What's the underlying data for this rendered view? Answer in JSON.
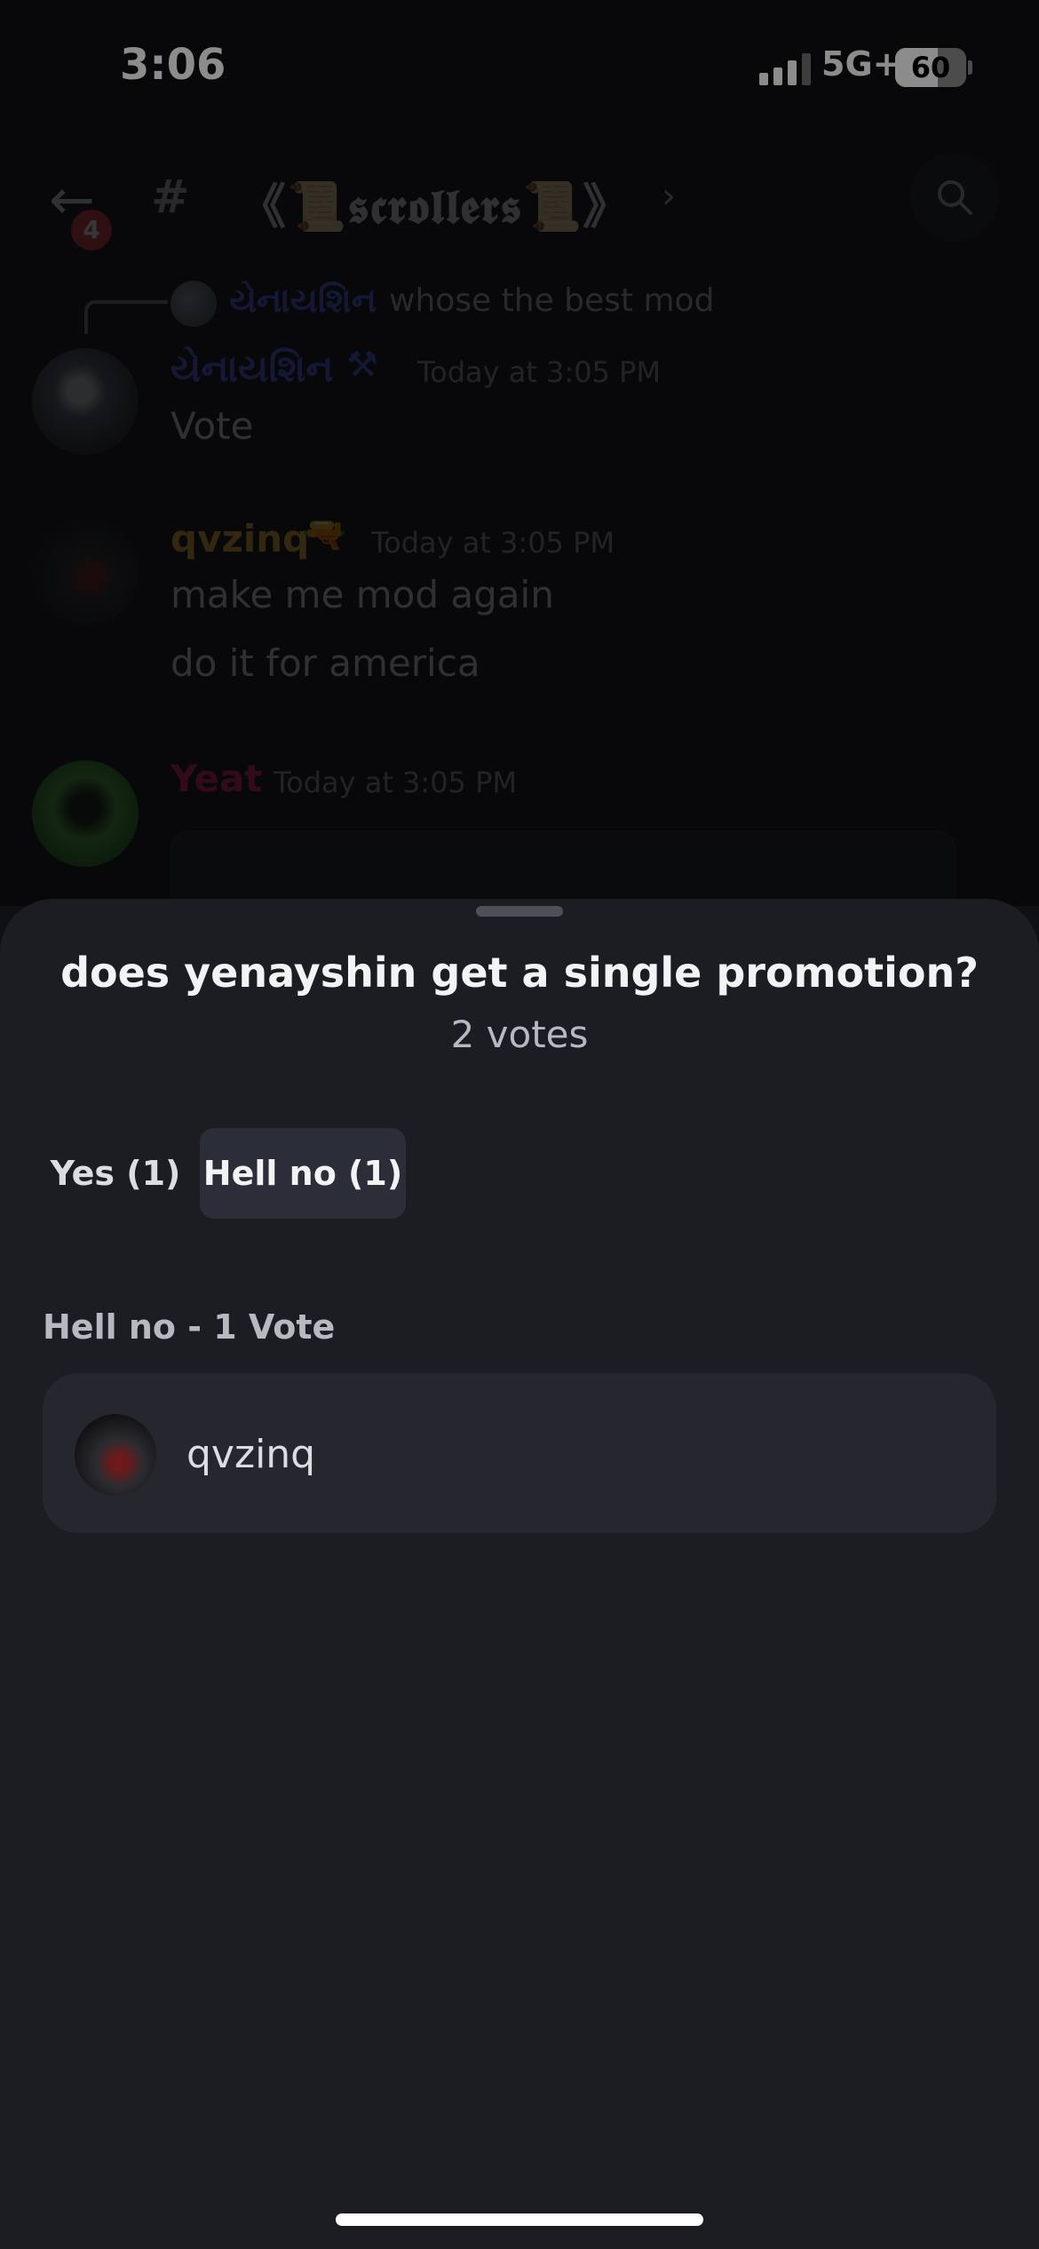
{
  "status_bar": {
    "time": "3:06",
    "network": "5G+",
    "battery": "60",
    "battery_level": 0.6,
    "signal_bars": 3
  },
  "header": {
    "unread_badge": "4",
    "channel_icon": "#",
    "channel_name": "《📜𝖘𝖈𝖗𝖔𝖑𝖑𝖊𝖗𝖘📜》",
    "chevron": "›"
  },
  "chat": {
    "reply": {
      "username": "યેનાયશિન",
      "text": "whose the best mod"
    },
    "messages": [
      {
        "username": "યેનાયશિન",
        "role_icon": "⚒",
        "timestamp": "Today at 3:05 PM",
        "lines": [
          "Vote"
        ]
      },
      {
        "username": "qvzinq",
        "role_icon": "🔫",
        "timestamp": "Today at 3:05 PM",
        "lines": [
          "make me mod again",
          "do it for america"
        ]
      },
      {
        "username": "Yeat",
        "timestamp": "Today at 3:05 PM",
        "lines": []
      }
    ]
  },
  "poll": {
    "question": "does yenayshin get a single promotion?",
    "total_votes": "2 votes",
    "tabs": [
      {
        "label": "Yes (1)",
        "selected": false
      },
      {
        "label": "Hell no (1)",
        "selected": true
      }
    ],
    "section_label": "Hell no - 1 Vote",
    "voters": [
      {
        "name": "qvzinq"
      }
    ]
  },
  "colors": {
    "sheet_bg": "#1c1d22",
    "card_bg": "#26272e",
    "selected_tab_bg": "#2b2d38",
    "mod_name": "#5865f2",
    "qvzinq_name": "#f0b232",
    "yeat_name": "#e91e63"
  }
}
